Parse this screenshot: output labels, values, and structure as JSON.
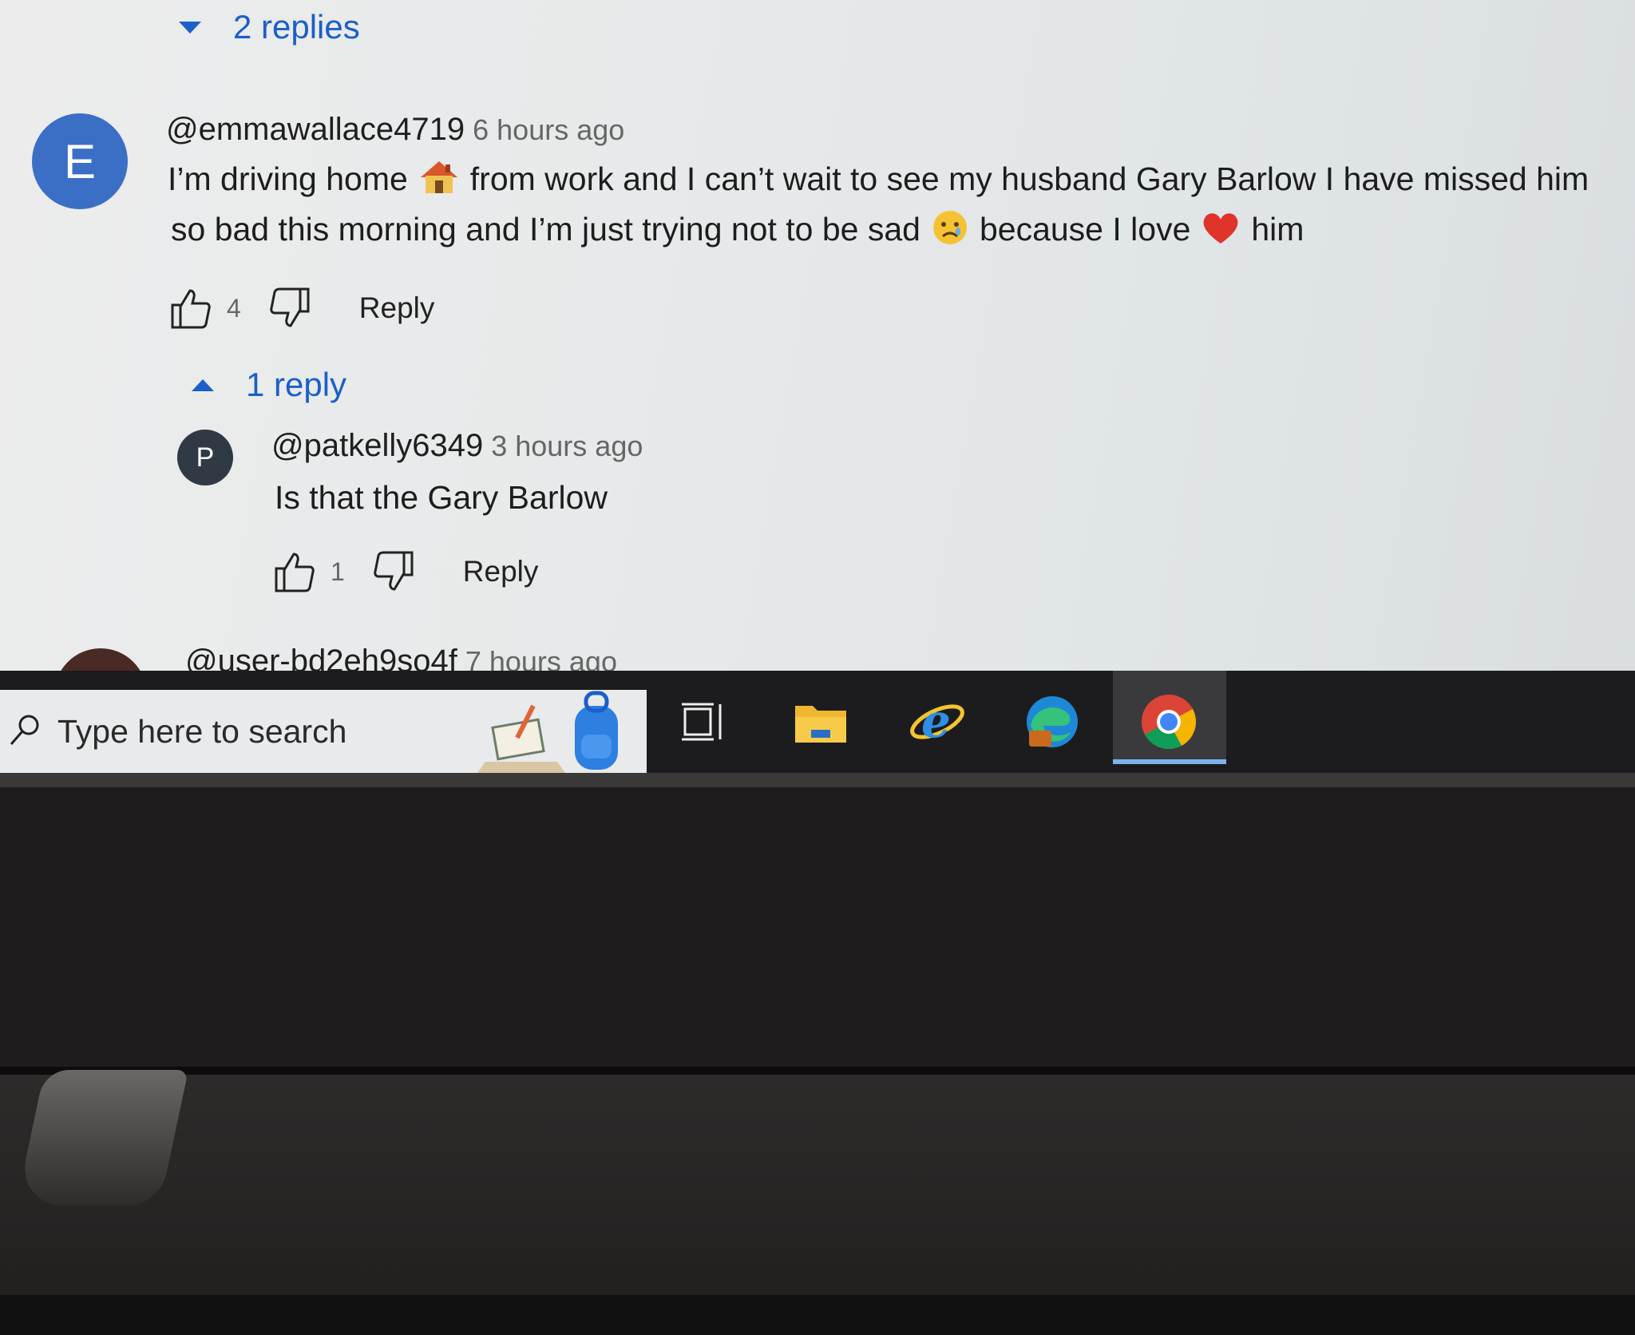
{
  "comments": [
    {
      "toggle_label": "2 replies",
      "avatar_letter": "E",
      "avatar_color": "#3b6fc6",
      "author": "@emmawallace4719",
      "time": "6 hours ago",
      "line1_part1": "I’m driving home",
      "line1_part2": "from work and I can’t wait to see my husband Gary Barlow I have missed him",
      "line2_part1": "so bad this morning and I’m just trying not to be sad",
      "line2_part2": "because I love",
      "line2_part3": "him",
      "emojis": [
        "house-emoji",
        "sad-face-emoji",
        "red-heart-emoji"
      ],
      "likes": "4",
      "reply_label": "Reply",
      "replies_toggle": "1 reply",
      "replies": [
        {
          "avatar_letter": "P",
          "avatar_color": "#2f3a44",
          "author": "@patkelly6349",
          "time": "3 hours ago",
          "text": "Is that the Gary Barlow",
          "likes": "1",
          "reply_label": "Reply"
        }
      ]
    },
    {
      "avatar_color": "#4a2a24",
      "author": "@user-bd2eh9so4f",
      "time": "7 hours ago"
    }
  ],
  "taskbar": {
    "search_placeholder": "Type here to search",
    "icons": [
      "search-icon",
      "news-widget-icon",
      "backpack-icon",
      "task-view-icon",
      "file-explorer-icon",
      "internet-explorer-icon",
      "edge-icon",
      "chrome-icon"
    ],
    "active_app": "chrome",
    "active_color": "#7fb2ec"
  }
}
